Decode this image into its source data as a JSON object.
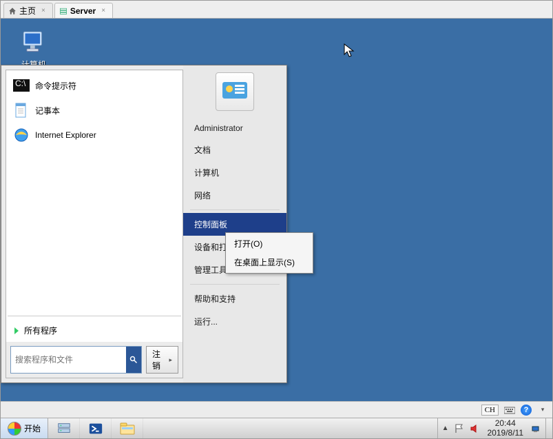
{
  "tabs": [
    {
      "label": "主页",
      "active": false
    },
    {
      "label": "Server",
      "active": true
    }
  ],
  "desktop": {
    "computer": {
      "label": "计算机"
    }
  },
  "start_menu": {
    "programs": [
      {
        "label": "命令提示符",
        "icon": "cmd-icon"
      },
      {
        "label": "记事本",
        "icon": "notepad-icon"
      },
      {
        "label": "Internet Explorer",
        "icon": "ie-icon"
      }
    ],
    "all_programs": "所有程序",
    "search_placeholder": "搜索程序和文件",
    "logoff_label": "注销",
    "right": {
      "user": "Administrator",
      "items": [
        {
          "label": "文档"
        },
        {
          "label": "计算机"
        },
        {
          "label": "网络"
        },
        {
          "label": "控制面板",
          "selected": true,
          "submenu": true
        },
        {
          "label": "设备和打印机"
        },
        {
          "label": "管理工具",
          "submenu": true
        },
        {
          "label": "帮助和支持"
        },
        {
          "label": "运行..."
        }
      ]
    }
  },
  "context_menu": {
    "items": [
      {
        "label": "打开(O)"
      },
      {
        "label": "在桌面上显示(S)"
      }
    ]
  },
  "imebar": {
    "lang": "CH"
  },
  "taskbar": {
    "start_label": "开始",
    "tray": {
      "time": "20:44",
      "date": "2019/8/11"
    }
  }
}
